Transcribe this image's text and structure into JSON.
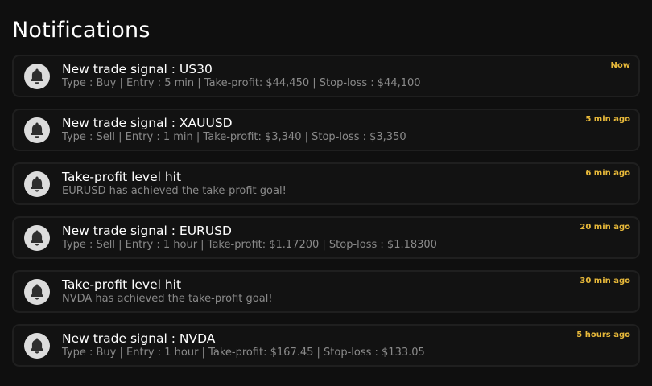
{
  "page": {
    "title": "Notifications"
  },
  "colors": {
    "background": "#0f0f0f",
    "card_border": "#1f1f1f",
    "title_text": "#ffffff",
    "detail_text": "#8a8a8a",
    "time_accent": "#e8b93a",
    "avatar_bg": "#dcdcdc"
  },
  "notifications": [
    {
      "icon": "bell-icon",
      "title": "New trade signal : US30",
      "detail": "Type : Buy | Entry : 5 min | Take-profit: $44,450 | Stop-loss : $44,100",
      "time": "Now"
    },
    {
      "icon": "bell-icon",
      "title": "New trade signal : XAUUSD",
      "detail": "Type : Sell | Entry : 1 min | Take-profit: $3,340 | Stop-loss : $3,350",
      "time": "5 min ago"
    },
    {
      "icon": "bell-icon",
      "title": "Take-profit level hit",
      "detail": "EURUSD has achieved the take-profit goal!",
      "time": "6 min ago"
    },
    {
      "icon": "bell-icon",
      "title": "New trade signal : EURUSD",
      "detail": "Type : Sell | Entry : 1 hour | Take-profit: $1.17200 | Stop-loss : $1.18300",
      "time": "20 min ago"
    },
    {
      "icon": "bell-icon",
      "title": "Take-profit level hit",
      "detail": "NVDA has achieved the take-profit goal!",
      "time": "30 min ago"
    },
    {
      "icon": "bell-icon",
      "title": "New trade signal : NVDA",
      "detail": "Type : Buy | Entry : 1 hour | Take-profit: $167.45 | Stop-loss : $133.05",
      "time": "5 hours ago"
    }
  ]
}
